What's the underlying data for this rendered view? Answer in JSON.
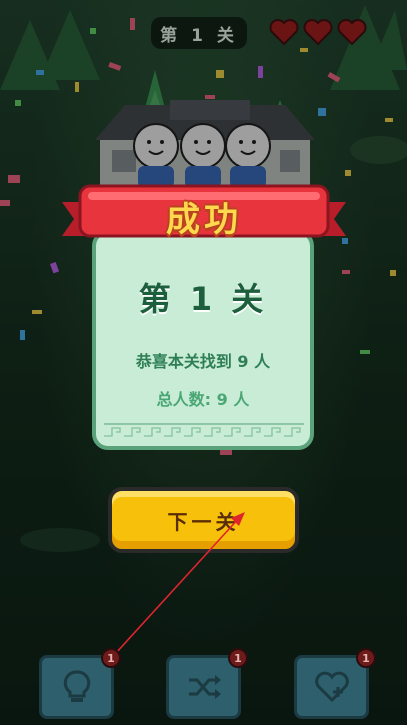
{
  "header": {
    "level_label": "第 1 关",
    "lives": 3
  },
  "result": {
    "banner_title": "成功",
    "level_label": "第 1 关",
    "found_text": "恭喜本关找到 9 人",
    "total_text": "总人数: 9 人"
  },
  "actions": {
    "next_label": "下一关"
  },
  "tools": [
    {
      "name": "hint",
      "badge": "1"
    },
    {
      "name": "shuffle",
      "badge": "1"
    },
    {
      "name": "add-life",
      "badge": "1"
    }
  ],
  "colors": {
    "ribbon": "#e8343c",
    "button": "#f7c10b",
    "panel": "#c9ecd6",
    "pointer": "#e0242c"
  }
}
